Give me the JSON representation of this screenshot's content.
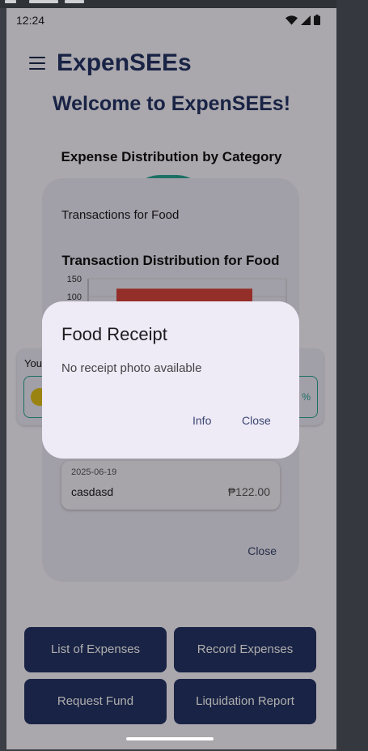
{
  "status_bar": {
    "time": "12:24"
  },
  "app": {
    "title": "ExpenSEEs"
  },
  "home": {
    "welcome": "Welcome to ExpenSEEs!",
    "distribution_title": "Expense Distribution by Category",
    "card_label": "You",
    "card_percent": "%"
  },
  "transactions_dialog": {
    "title": "Transactions for Food",
    "chart_title": "Transaction Distribution for Food",
    "item": {
      "date": "2025-06-19",
      "description": "casdasd",
      "amount": "₱122.00"
    },
    "close_label": "Close"
  },
  "chart_data": {
    "type": "bar",
    "title": "Transaction Distribution for Food",
    "categories": [
      "casdasd"
    ],
    "values": [
      122
    ],
    "y_ticks_visible": [
      150,
      100
    ],
    "ylim": [
      0,
      150
    ]
  },
  "receipt_dialog": {
    "title": "Food Receipt",
    "message": "No receipt photo available",
    "info_label": "Info",
    "close_label": "Close"
  },
  "bottom_buttons": {
    "list_expenses": "List of Expenses",
    "record_expenses": "Record Expenses",
    "request_fund": "Request Fund",
    "liquidation_report": "Liquidation Report"
  },
  "colors": {
    "primary": "#263466",
    "accent_teal": "#2aa597",
    "bar_red": "#d9453b",
    "dialog_surface": "#eeeaf6"
  }
}
